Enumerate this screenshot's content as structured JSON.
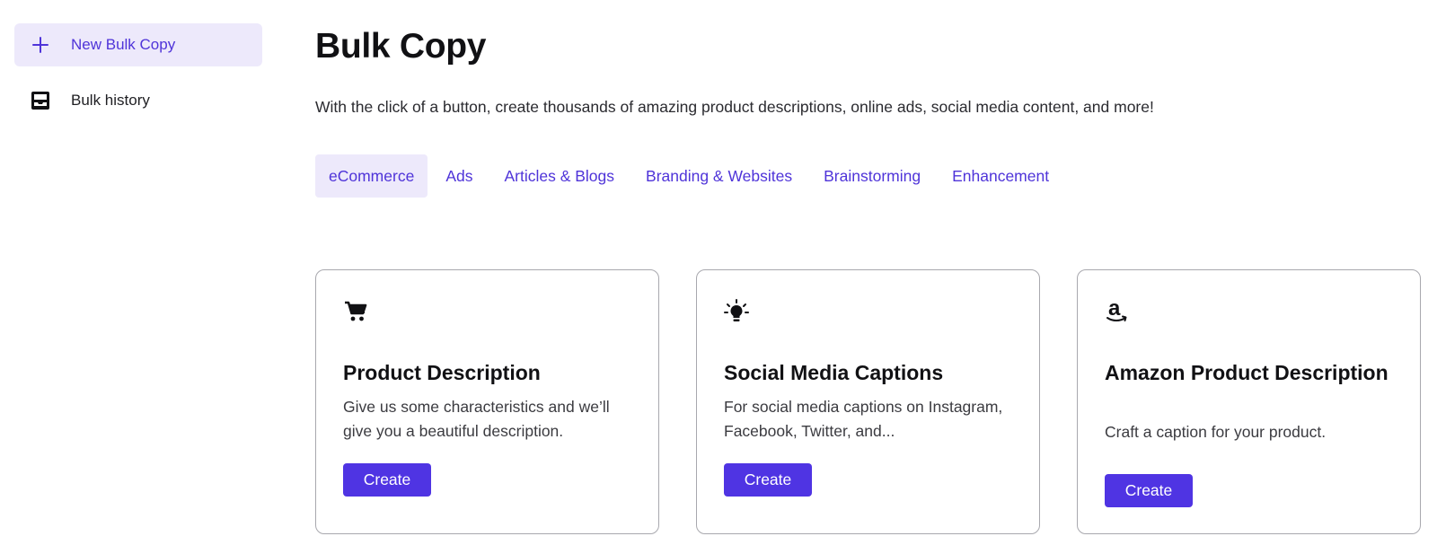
{
  "sidebar": {
    "items": [
      {
        "label": "New Bulk Copy",
        "icon": "plus-icon",
        "active": true
      },
      {
        "label": "Bulk history",
        "icon": "inbox-tray-icon",
        "active": false
      }
    ]
  },
  "main": {
    "title": "Bulk Copy",
    "subtitle": "With the click of a button, create thousands of amazing product descriptions, online ads, social media content, and more!",
    "tabs": [
      {
        "label": "eCommerce",
        "active": true
      },
      {
        "label": "Ads",
        "active": false
      },
      {
        "label": "Articles & Blogs",
        "active": false
      },
      {
        "label": "Branding & Websites",
        "active": false
      },
      {
        "label": "Brainstorming",
        "active": false
      },
      {
        "label": "Enhancement",
        "active": false
      }
    ],
    "cards": [
      {
        "icon": "shopping-cart-icon",
        "title": "Product Description",
        "description": "Give us some characteristics and we’ll give you a beautiful description.",
        "button": "Create"
      },
      {
        "icon": "lightbulb-icon",
        "title": "Social Media Captions",
        "description": "For social media captions on Instagram, Facebook, Twitter, and...",
        "button": "Create"
      },
      {
        "icon": "amazon-logo-icon",
        "title": "Amazon Product Description",
        "description": "Craft a caption for your product.",
        "button": "Create"
      }
    ]
  },
  "colors": {
    "accent": "#4f34e3",
    "accent_text": "#4f34d9",
    "accent_bg": "#ede9fb",
    "card_border": "#a8a8ae"
  }
}
